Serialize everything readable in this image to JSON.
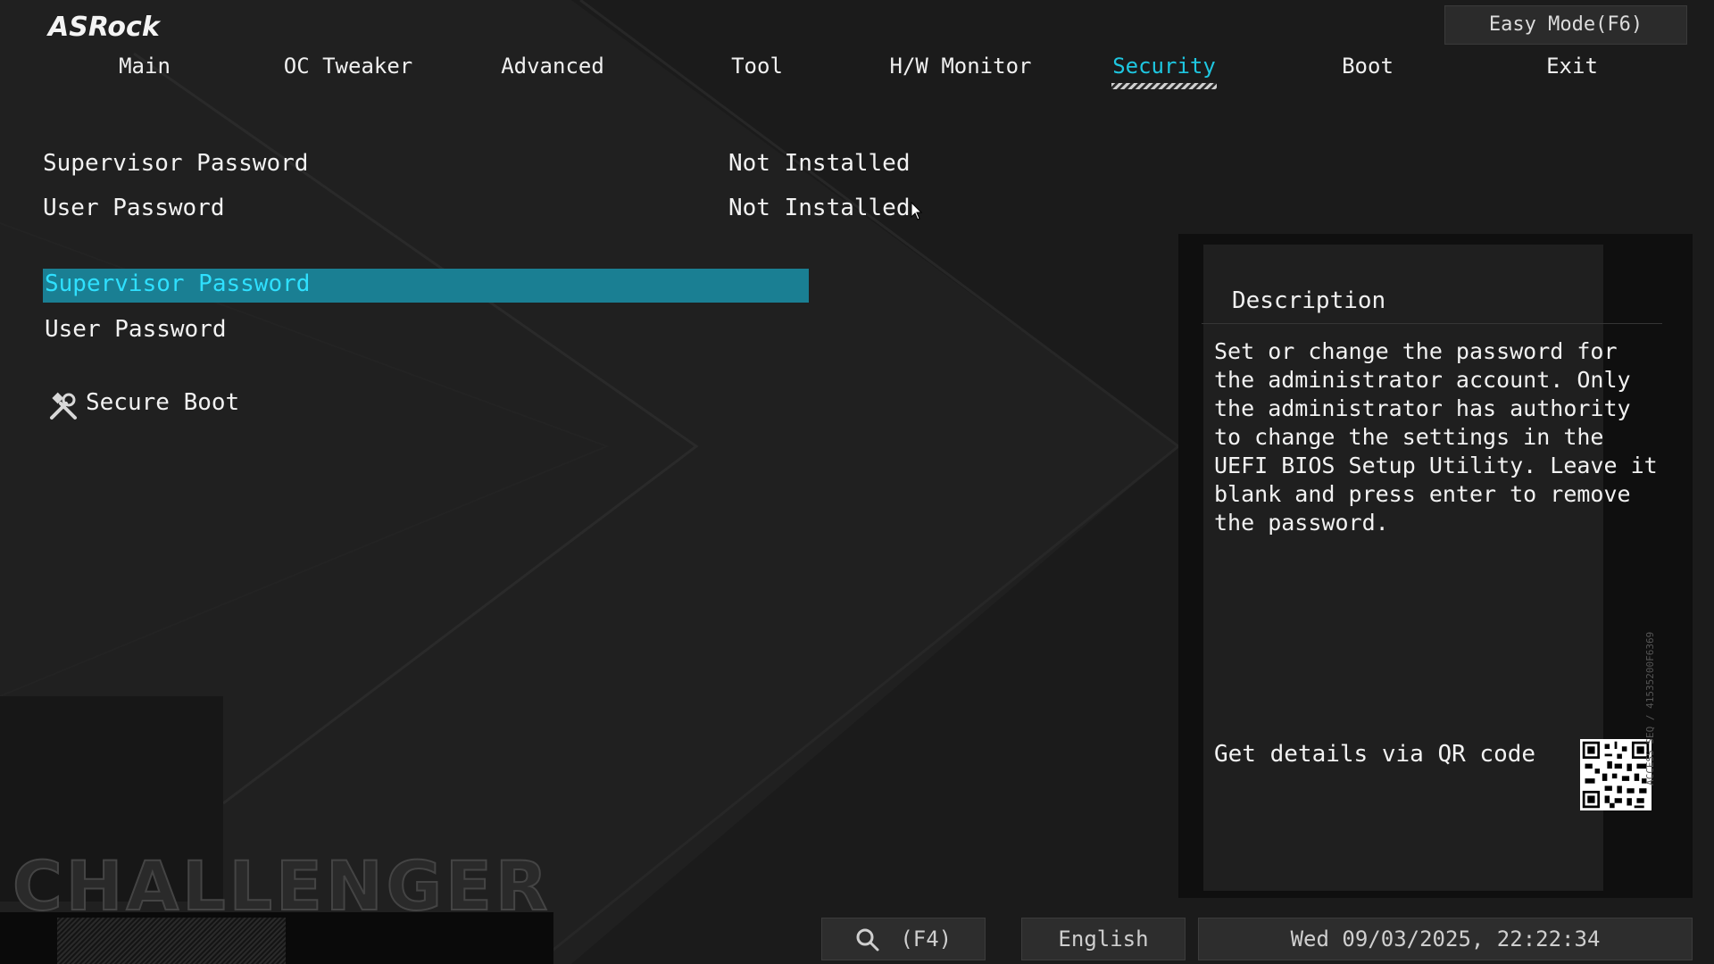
{
  "brand": {
    "logo_text": "ASRock",
    "watermark": "CHALLENGER"
  },
  "header": {
    "easy_mode_label": "Easy Mode(F6)",
    "tabs": [
      {
        "label": "Main"
      },
      {
        "label": "OC Tweaker"
      },
      {
        "label": "Advanced"
      },
      {
        "label": "Tool"
      },
      {
        "label": "H/W Monitor"
      },
      {
        "label": "Security",
        "active": true
      },
      {
        "label": "Boot"
      },
      {
        "label": "Exit"
      }
    ]
  },
  "status": {
    "supervisor": {
      "label": "Supervisor Password",
      "value": "Not Installed"
    },
    "user": {
      "label": "User Password",
      "value": "Not Installed"
    }
  },
  "menu": {
    "supervisor_password": "Supervisor Password",
    "user_password": "User Password",
    "secure_boot": "Secure Boot",
    "secure_boot_icon": "tools-icon"
  },
  "description": {
    "title": "Description",
    "text": "Set or change the password for the administrator account. Only the administrator has authority to change the settings in the UEFI BIOS Setup Utility. Leave it blank and press enter to remove the password.",
    "qr_label": "Get details via QR code",
    "serial_text": "ACCESS SEQ / 41535200F6369"
  },
  "footer": {
    "search_label": "(F4)",
    "language": "English",
    "datetime": "Wed 09/03/2025, 22:22:34"
  },
  "colors": {
    "accent": "#1ec6e0",
    "highlight": "#1a7f93",
    "background": "#1b1b1b"
  }
}
